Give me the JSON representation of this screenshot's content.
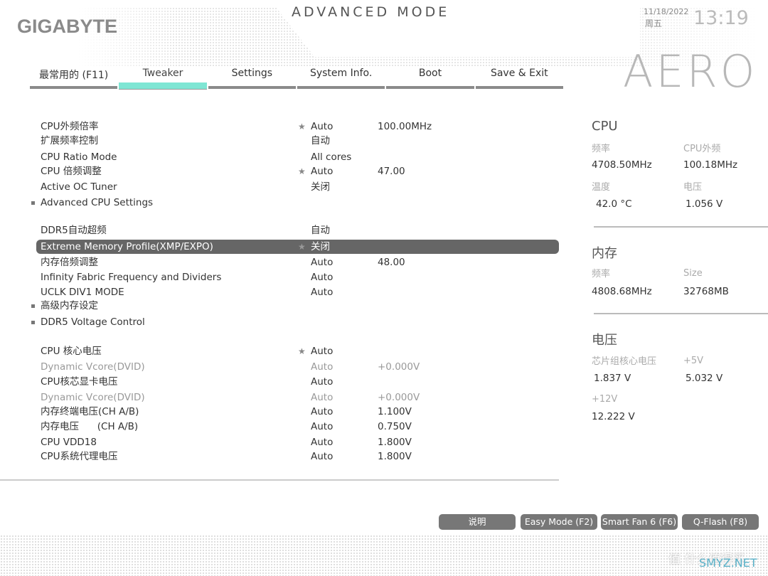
{
  "header": {
    "logo": "GIGABYTE",
    "mode": "ADVANCED MODE",
    "date": "11/18/2022",
    "weekday": "周五",
    "time": "13:19",
    "brand": "AERO"
  },
  "tabs": [
    {
      "label": "最常用的 (F11)"
    },
    {
      "label": "Tweaker",
      "active": true
    },
    {
      "label": "Settings"
    },
    {
      "label": "System Info."
    },
    {
      "label": "Boot"
    },
    {
      "label": "Save & Exit"
    }
  ],
  "accent_color": "#7fe6d4",
  "settings": [
    {
      "label": "CPU外频倍率",
      "star": true,
      "value": "Auto",
      "extra": "100.00MHz"
    },
    {
      "label": "扩展频率控制",
      "value": "自动"
    },
    {
      "label": "CPU Ratio Mode",
      "value": "All cores"
    },
    {
      "label": "CPU 倍频调整",
      "star": true,
      "value": "Auto",
      "extra": "47.00"
    },
    {
      "label": "Active OC Tuner",
      "value": "关闭"
    },
    {
      "label": "Advanced CPU Settings",
      "submenu": true
    },
    {
      "label": "DDR5自动超频",
      "value": "自动"
    },
    {
      "label": "Extreme Memory Profile(XMP/EXPO)",
      "star": true,
      "value": "关闭",
      "selected": true
    },
    {
      "label": "内存倍频调整",
      "value": "Auto",
      "extra": "48.00"
    },
    {
      "label": "Infinity Fabric Frequency and Dividers",
      "value": "Auto"
    },
    {
      "label": "UCLK DIV1 MODE",
      "value": "Auto"
    },
    {
      "label": "高级内存设定",
      "submenu": true
    },
    {
      "label": "DDR5 Voltage Control",
      "submenu": true
    },
    {
      "label": "CPU 核心电压",
      "star": true,
      "value": "Auto"
    },
    {
      "label": "Dynamic Vcore(DVID)",
      "value": "Auto",
      "extra": "+0.000V",
      "dim": true
    },
    {
      "label": "CPU核芯显卡电压",
      "value": "Auto"
    },
    {
      "label": "Dynamic Vcore(DVID)",
      "value": "Auto",
      "extra": "+0.000V",
      "dim": true
    },
    {
      "label": "内存终端电压(CH A/B)",
      "value": "Auto",
      "extra": "1.100V"
    },
    {
      "label": "内存电压      (CH A/B)",
      "value": "Auto",
      "extra": "0.750V"
    },
    {
      "label": "CPU VDD18",
      "value": "Auto",
      "extra": "1.800V"
    },
    {
      "label": "CPU系统代理电压",
      "value": "Auto",
      "extra": "1.800V"
    }
  ],
  "panel": {
    "cpu": {
      "title": "CPU",
      "freq_label": "频率",
      "freq": "4708.50MHz",
      "bclk_label": "CPU外频",
      "bclk": "100.18MHz",
      "temp_label": "温度",
      "temp": "42.0 °C",
      "volt_label": "电压",
      "volt": "1.056 V"
    },
    "mem": {
      "title": "内存",
      "freq_label": "频率",
      "freq": "4808.68MHz",
      "size_label": "Size",
      "size": "32768MB"
    },
    "volt": {
      "title": "电压",
      "chipset_label": "芯片组核心电压",
      "chipset": "1.837 V",
      "v5_label": "+5V",
      "v5": "5.032 V",
      "v12_label": "+12V",
      "v12": "12.222 V"
    }
  },
  "buttons": [
    {
      "label": "说明"
    },
    {
      "label": "Easy Mode (F2)"
    },
    {
      "label": "Smart Fan 6 (F6)"
    },
    {
      "label": "Q-Flash (F8)"
    }
  ],
  "watermark": {
    "text": "值 什么值得买",
    "site": "SMYZ.NET"
  }
}
